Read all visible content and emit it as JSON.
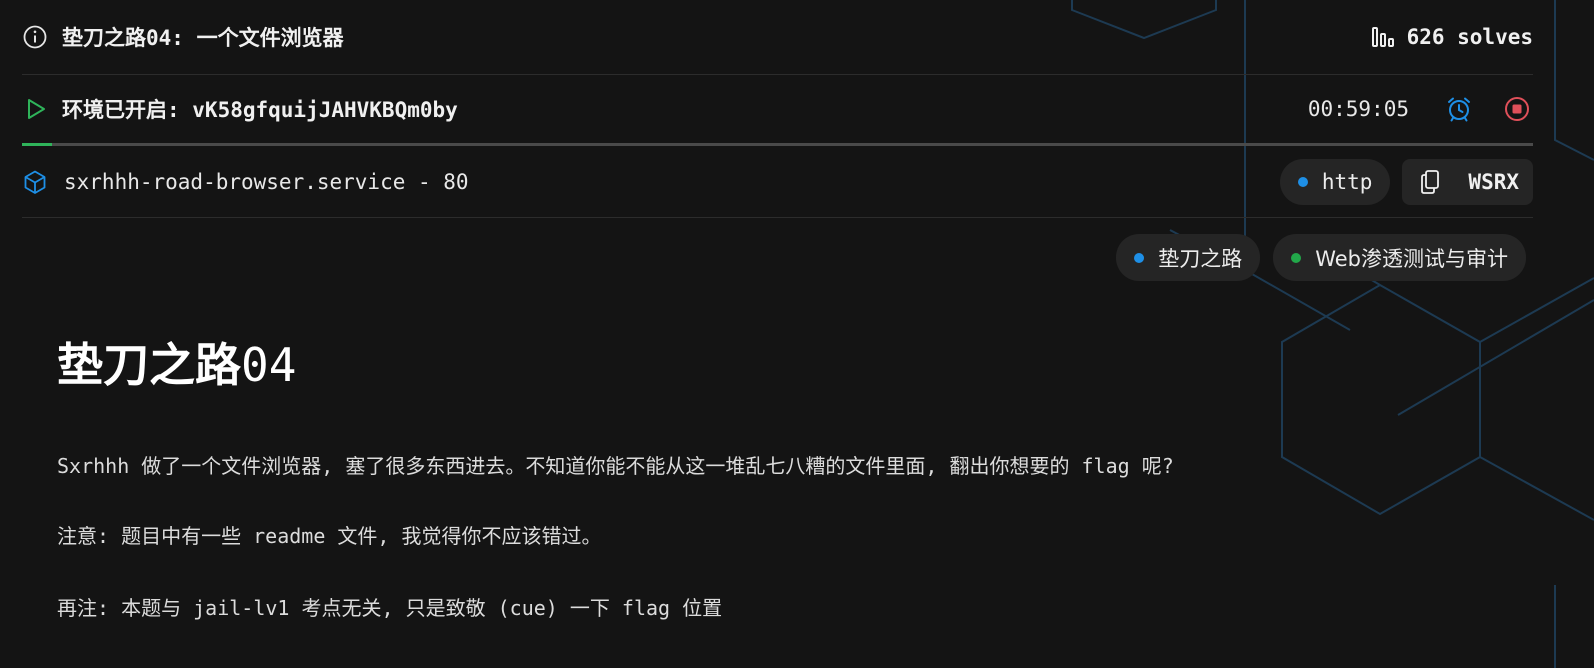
{
  "challenge": {
    "title": "垫刀之路04: 一个文件浏览器",
    "solves": "626 solves"
  },
  "environment": {
    "label": "环境已开启: vK58gfquijJAHVKBQm0by",
    "timer": "00:59:05",
    "progress_fraction": 0.02
  },
  "service": {
    "name": "sxrhhh-road-browser.service - 80",
    "protocol": "http",
    "wsrx_label": "WSRX"
  },
  "tags": [
    {
      "label": "垫刀之路",
      "color": "#1e8fe6"
    },
    {
      "label": "Web渗透测试与审计",
      "color": "#22a84a"
    }
  ],
  "content": {
    "heading_main": "垫刀之路",
    "heading_num": "04",
    "paragraphs": [
      "Sxrhhh 做了一个文件浏览器, 塞了很多东西进去。不知道你能不能从这一堆乱七八糟的文件里面, 翻出你想要的 flag 呢?",
      "注意: 题目中有一些 readme 文件, 我觉得你不应该错过。",
      "再注: 本题与 jail-lv1 考点无关, 只是致敬 (cue) 一下 flag 位置"
    ]
  },
  "icons": {
    "title": "info-circle-icon",
    "solves": "bar-chart-icon",
    "env": "play-icon",
    "alarm": "alarm-clock-icon",
    "stop": "stop-circle-icon",
    "service": "cube-icon",
    "copy": "copy-icon"
  },
  "colors": {
    "accent_blue": "#1e8fe6",
    "accent_green": "#2fb35a",
    "stop_red": "#e0505a",
    "background": "#141414"
  }
}
